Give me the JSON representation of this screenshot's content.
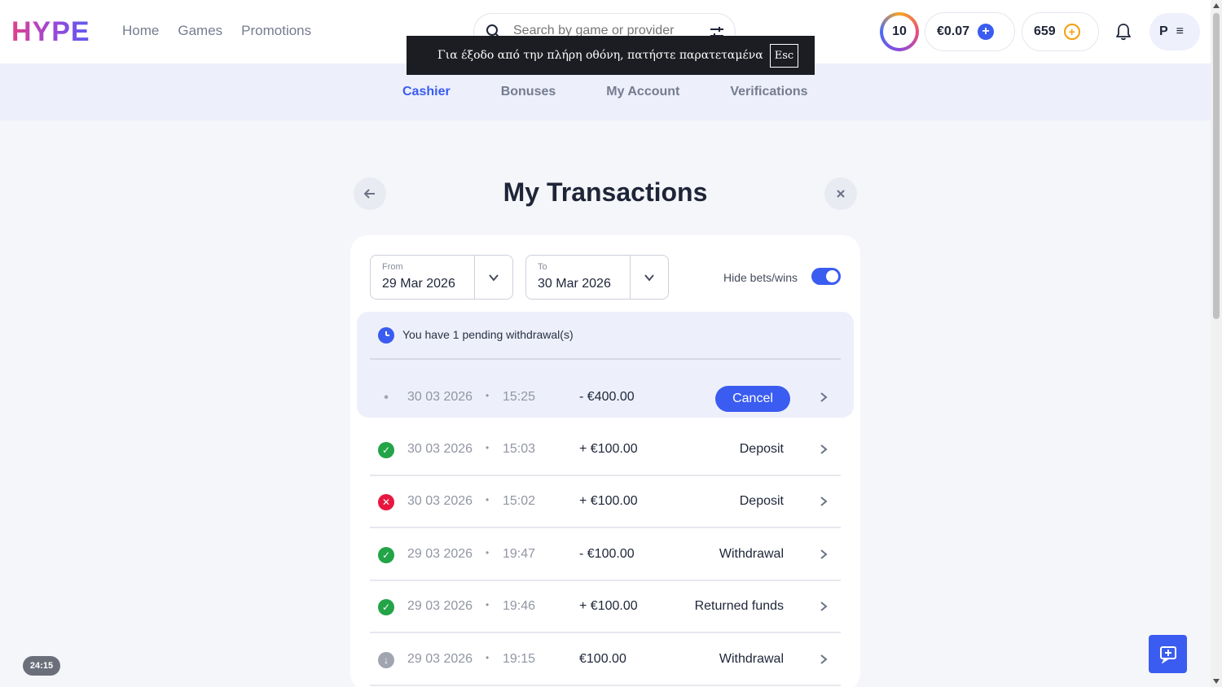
{
  "header": {
    "logo": "HYPE",
    "nav": [
      "Home",
      "Games",
      "Promotions"
    ],
    "search_placeholder": "Search by game or provider",
    "level": "10",
    "balance": "€0.07",
    "points": "659",
    "avatar_initial": "P"
  },
  "fullscreen_banner": {
    "text": "Για έξοδο από την πλήρη οθόνη, πατήστε παρατεταμένα",
    "key": "Esc"
  },
  "subnav": {
    "tabs": [
      "Cashier",
      "Bonuses",
      "My Account",
      "Verifications"
    ],
    "active": "Cashier"
  },
  "page": {
    "title": "My Transactions"
  },
  "filters": {
    "from_label": "From",
    "from_value": "29 Mar 2026",
    "to_label": "To",
    "to_value": "30 Mar 2026",
    "hide_bets_label": "Hide bets/wins",
    "hide_bets_on": true
  },
  "pending": {
    "message": "You have 1 pending withdrawal(s)",
    "row": {
      "date": "30 03 2026",
      "time": "15:25",
      "amount": "- €400.00",
      "action": "Cancel"
    }
  },
  "transactions": [
    {
      "status": "success",
      "date": "30 03 2026",
      "time": "15:03",
      "amount": "+ €100.00",
      "type": "Deposit"
    },
    {
      "status": "failed",
      "date": "30 03 2026",
      "time": "15:02",
      "amount": "+ €100.00",
      "type": "Deposit"
    },
    {
      "status": "success",
      "date": "29 03 2026",
      "time": "19:47",
      "amount": "- €100.00",
      "type": "Withdrawal"
    },
    {
      "status": "success",
      "date": "29 03 2026",
      "time": "19:46",
      "amount": "+ €100.00",
      "type": "Returned funds"
    },
    {
      "status": "processing",
      "date": "29 03 2026",
      "time": "19:15",
      "amount": "€100.00",
      "type": "Withdrawal"
    }
  ],
  "timer": "24:15",
  "colors": {
    "accent": "#3b5cf0",
    "success": "#22a447",
    "failed": "#e8173f"
  }
}
